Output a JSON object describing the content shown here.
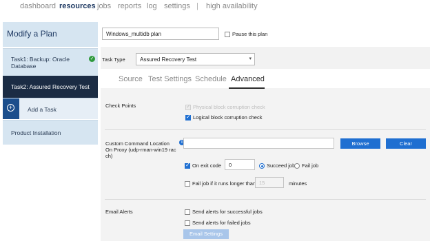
{
  "nav": {
    "items": [
      "dashboard",
      "resources",
      "jobs",
      "reports",
      "log",
      "settings",
      "|",
      "high availability"
    ],
    "active": "resources"
  },
  "sidebar": {
    "title": "Modify a Plan",
    "task1": "Task1: Backup: Oracle Database",
    "task2": "Task2: Assured Recovery Test",
    "add_task": "Add a Task",
    "product_installation": "Product Installation"
  },
  "plan": {
    "name": "Windows_multidb plan",
    "pause_label": "Pause this plan",
    "pause_checked": false
  },
  "task_type": {
    "label": "Task Type",
    "value": "Assured Recovery Test"
  },
  "tabs": [
    "Source",
    "Test Settings",
    "Schedule",
    "Advanced"
  ],
  "active_tab": "Advanced",
  "checkpoints": {
    "label": "Check Points",
    "physical": "Physical block corruption check",
    "logical": "Logical block corruption check",
    "physical_checked": true,
    "physical_disabled": true,
    "logical_checked": true
  },
  "custom_command": {
    "label": "Custom Command Location On Proxy (udp-rman-win19 rac ch)",
    "value": "",
    "browse": "Browse",
    "clear": "Clear"
  },
  "exit_code": {
    "label": "On exit code",
    "checked": true,
    "value": "0",
    "succeed": "Succeed job",
    "fail": "Fail job",
    "selected": "succeed"
  },
  "fail_job": {
    "label": "Fail job if it runs longer than",
    "checked": false,
    "value": "15",
    "unit": "minutes"
  },
  "email": {
    "label": "Email Alerts",
    "success": "Send alerts for successful jobs",
    "failed": "Send alerts for failed jobs",
    "settings": "Email Settings"
  },
  "colors": {
    "accent": "#1f6fd1",
    "sidebar_active": "#1b2c44",
    "sidebar_bg": "#d6e5f1",
    "success": "#2e9a3c"
  }
}
